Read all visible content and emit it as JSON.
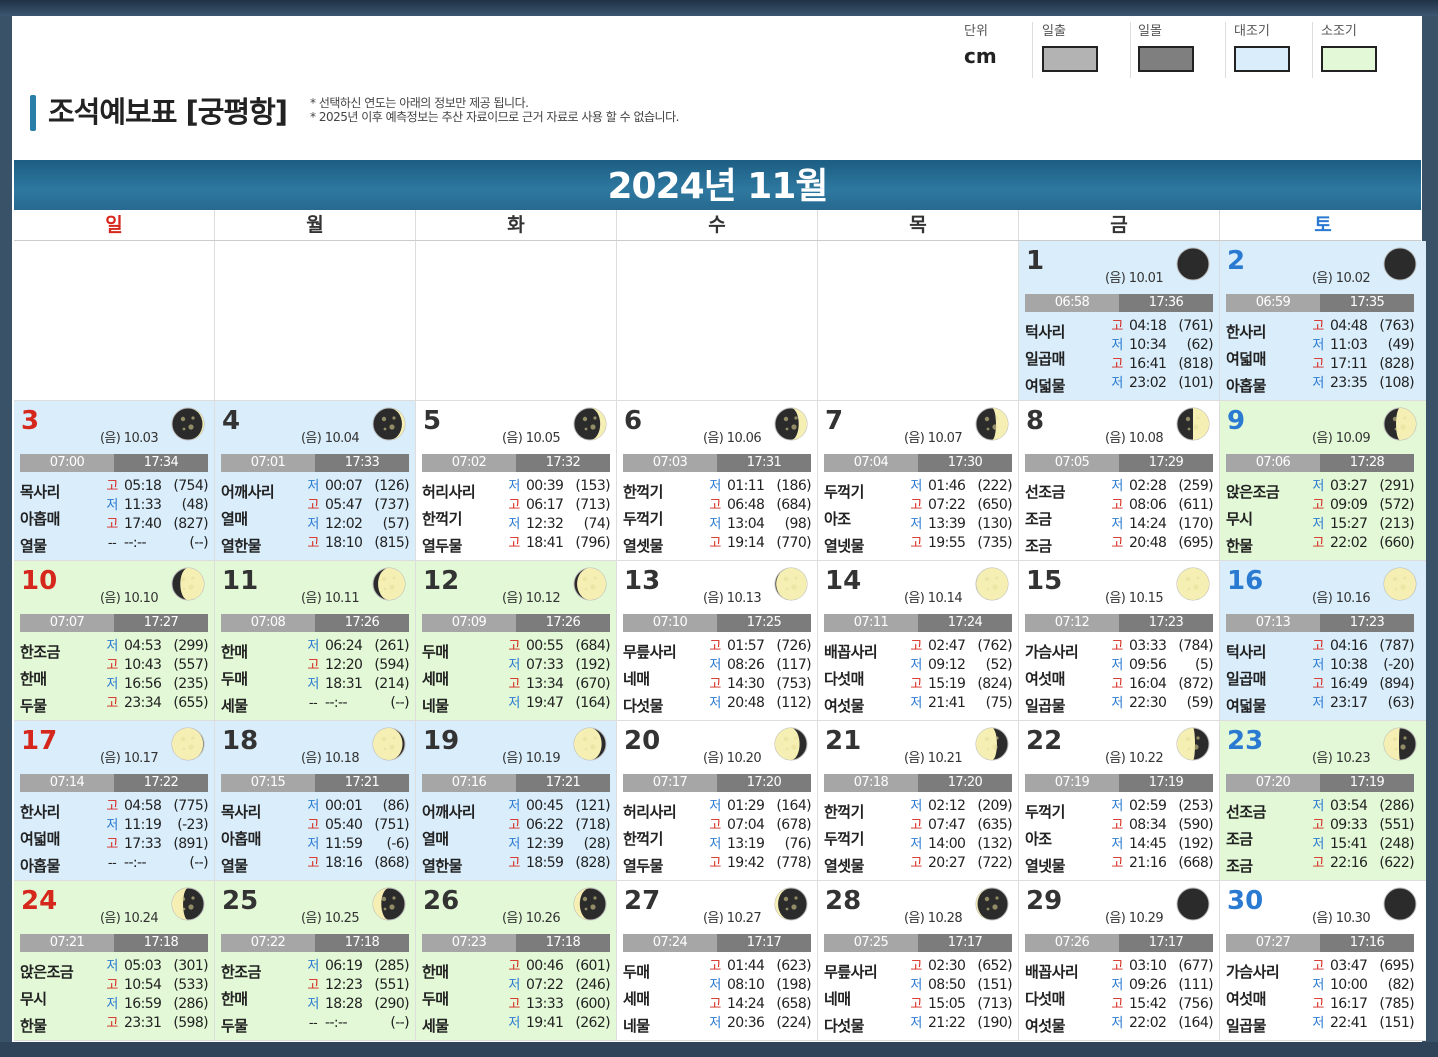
{
  "page": {
    "title": "조석예보표 [궁평항]",
    "notes": [
      "* 선택하신 연도는 아래의 정보만 제공 됩니다.",
      "* 2025년 이후 예측정보는 추산 자료이므로 근거 자료로 사용 할 수 없습니다."
    ]
  },
  "legend": {
    "unit_label": "단위",
    "unit_value": "cm",
    "items": [
      {
        "label": "일출",
        "color": "#b3b3b3"
      },
      {
        "label": "일몰",
        "color": "#7f7f7f"
      },
      {
        "label": "대조기",
        "color": "#d9edfb"
      },
      {
        "label": "소조기",
        "color": "#e2f8d6"
      }
    ]
  },
  "calendar": {
    "month_title": "2024년 11월",
    "weekdays": [
      "일",
      "월",
      "화",
      "수",
      "목",
      "금",
      "토"
    ],
    "days": [
      {
        "day": "1",
        "lunar": "(음) 10.01",
        "phase": 0.0,
        "period": "big",
        "sunrise": "06:58",
        "sunset": "17:36",
        "names": [
          "턱사리",
          "일곱매",
          "여덟물"
        ],
        "tides": [
          [
            "고",
            "04:18",
            "(761)"
          ],
          [
            "저",
            "10:34",
            "(62)"
          ],
          [
            "고",
            "16:41",
            "(818)"
          ],
          [
            "저",
            "23:02",
            "(101)"
          ]
        ]
      },
      {
        "day": "2",
        "lunar": "(음) 10.02",
        "phase": 0.03,
        "period": "big",
        "sunrise": "06:59",
        "sunset": "17:35",
        "names": [
          "한사리",
          "여덟매",
          "아홉물"
        ],
        "tides": [
          [
            "고",
            "04:48",
            "(763)"
          ],
          [
            "저",
            "11:03",
            "(49)"
          ],
          [
            "고",
            "17:11",
            "(828)"
          ],
          [
            "저",
            "23:35",
            "(108)"
          ]
        ]
      },
      {
        "day": "3",
        "lunar": "(음) 10.03",
        "phase": 0.07,
        "period": "big",
        "sunrise": "07:00",
        "sunset": "17:34",
        "names": [
          "목사리",
          "아홉매",
          "열물"
        ],
        "tides": [
          [
            "고",
            "05:18",
            "(754)"
          ],
          [
            "저",
            "11:33",
            "(48)"
          ],
          [
            "고",
            "17:40",
            "(827)"
          ],
          [
            "--",
            "--:--",
            "(--)"
          ]
        ]
      },
      {
        "day": "4",
        "lunar": "(음) 10.04",
        "phase": 0.1,
        "period": "big",
        "sunrise": "07:01",
        "sunset": "17:33",
        "names": [
          "어깨사리",
          "열매",
          "열한물"
        ],
        "tides": [
          [
            "저",
            "00:07",
            "(126)"
          ],
          [
            "고",
            "05:47",
            "(737)"
          ],
          [
            "저",
            "12:02",
            "(57)"
          ],
          [
            "고",
            "18:10",
            "(815)"
          ]
        ]
      },
      {
        "day": "5",
        "lunar": "(음) 10.05",
        "phase": 0.14,
        "period": "plain",
        "sunrise": "07:02",
        "sunset": "17:32",
        "names": [
          "허리사리",
          "한꺽기",
          "열두물"
        ],
        "tides": [
          [
            "저",
            "00:39",
            "(153)"
          ],
          [
            "고",
            "06:17",
            "(713)"
          ],
          [
            "저",
            "12:32",
            "(74)"
          ],
          [
            "고",
            "18:41",
            "(796)"
          ]
        ]
      },
      {
        "day": "6",
        "lunar": "(음) 10.06",
        "phase": 0.17,
        "period": "plain",
        "sunrise": "07:03",
        "sunset": "17:31",
        "names": [
          "한꺽기",
          "두꺽기",
          "열셋물"
        ],
        "tides": [
          [
            "저",
            "01:11",
            "(186)"
          ],
          [
            "고",
            "06:48",
            "(684)"
          ],
          [
            "저",
            "13:04",
            "(98)"
          ],
          [
            "고",
            "19:14",
            "(770)"
          ]
        ]
      },
      {
        "day": "7",
        "lunar": "(음) 10.07",
        "phase": 0.21,
        "period": "plain",
        "sunrise": "07:04",
        "sunset": "17:30",
        "names": [
          "두꺽기",
          "아조",
          "열넷물"
        ],
        "tides": [
          [
            "저",
            "01:46",
            "(222)"
          ],
          [
            "고",
            "07:22",
            "(650)"
          ],
          [
            "저",
            "13:39",
            "(130)"
          ],
          [
            "고",
            "19:55",
            "(735)"
          ]
        ]
      },
      {
        "day": "8",
        "lunar": "(음) 10.08",
        "phase": 0.25,
        "period": "plain",
        "sunrise": "07:05",
        "sunset": "17:29",
        "names": [
          "선조금",
          "조금",
          "조금"
        ],
        "tides": [
          [
            "저",
            "02:28",
            "(259)"
          ],
          [
            "고",
            "08:06",
            "(611)"
          ],
          [
            "저",
            "14:24",
            "(170)"
          ],
          [
            "고",
            "20:48",
            "(695)"
          ]
        ]
      },
      {
        "day": "9",
        "lunar": "(음) 10.09",
        "phase": 0.29,
        "period": "small",
        "sunrise": "07:06",
        "sunset": "17:28",
        "names": [
          "앉은조금",
          "무시",
          "한물"
        ],
        "tides": [
          [
            "저",
            "03:27",
            "(291)"
          ],
          [
            "고",
            "09:09",
            "(572)"
          ],
          [
            "저",
            "15:27",
            "(213)"
          ],
          [
            "고",
            "22:02",
            "(660)"
          ]
        ]
      },
      {
        "day": "10",
        "lunar": "(음) 10.10",
        "phase": 0.33,
        "period": "small",
        "sunrise": "07:07",
        "sunset": "17:27",
        "names": [
          "한조금",
          "한매",
          "두물"
        ],
        "tides": [
          [
            "저",
            "04:53",
            "(299)"
          ],
          [
            "고",
            "10:43",
            "(557)"
          ],
          [
            "저",
            "16:56",
            "(235)"
          ],
          [
            "고",
            "23:34",
            "(655)"
          ]
        ]
      },
      {
        "day": "11",
        "lunar": "(음) 10.11",
        "phase": 0.37,
        "period": "small",
        "sunrise": "07:08",
        "sunset": "17:26",
        "names": [
          "한매",
          "두매",
          "세물"
        ],
        "tides": [
          [
            "저",
            "06:24",
            "(261)"
          ],
          [
            "고",
            "12:20",
            "(594)"
          ],
          [
            "저",
            "18:31",
            "(214)"
          ],
          [
            "--",
            "--:--",
            "(--)"
          ]
        ]
      },
      {
        "day": "12",
        "lunar": "(음) 10.12",
        "phase": 0.4,
        "period": "small",
        "sunrise": "07:09",
        "sunset": "17:26",
        "names": [
          "두매",
          "세매",
          "네물"
        ],
        "tides": [
          [
            "고",
            "00:55",
            "(684)"
          ],
          [
            "저",
            "07:33",
            "(192)"
          ],
          [
            "고",
            "13:34",
            "(670)"
          ],
          [
            "저",
            "19:47",
            "(164)"
          ]
        ]
      },
      {
        "day": "13",
        "lunar": "(음) 10.13",
        "phase": 0.44,
        "period": "plain",
        "sunrise": "07:10",
        "sunset": "17:25",
        "names": [
          "무릎사리",
          "네매",
          "다섯물"
        ],
        "tides": [
          [
            "고",
            "01:57",
            "(726)"
          ],
          [
            "저",
            "08:26",
            "(117)"
          ],
          [
            "고",
            "14:30",
            "(753)"
          ],
          [
            "저",
            "20:48",
            "(112)"
          ]
        ]
      },
      {
        "day": "14",
        "lunar": "(음) 10.14",
        "phase": 0.47,
        "period": "plain",
        "sunrise": "07:11",
        "sunset": "17:24",
        "names": [
          "배꼽사리",
          "다섯매",
          "여섯물"
        ],
        "tides": [
          [
            "고",
            "02:47",
            "(762)"
          ],
          [
            "저",
            "09:12",
            "(52)"
          ],
          [
            "고",
            "15:19",
            "(824)"
          ],
          [
            "저",
            "21:41",
            "(75)"
          ]
        ]
      },
      {
        "day": "15",
        "lunar": "(음) 10.15",
        "phase": 0.5,
        "period": "plain",
        "sunrise": "07:12",
        "sunset": "17:23",
        "names": [
          "가슴사리",
          "여섯매",
          "일곱물"
        ],
        "tides": [
          [
            "고",
            "03:33",
            "(784)"
          ],
          [
            "저",
            "09:56",
            "(5)"
          ],
          [
            "고",
            "16:04",
            "(872)"
          ],
          [
            "저",
            "22:30",
            "(59)"
          ]
        ]
      },
      {
        "day": "16",
        "lunar": "(음) 10.16",
        "phase": 0.52,
        "period": "big",
        "sunrise": "07:13",
        "sunset": "17:23",
        "names": [
          "턱사리",
          "일곱매",
          "여덟물"
        ],
        "tides": [
          [
            "고",
            "04:16",
            "(787)"
          ],
          [
            "저",
            "10:38",
            "(-20)"
          ],
          [
            "고",
            "16:49",
            "(894)"
          ],
          [
            "저",
            "23:17",
            "(63)"
          ]
        ]
      },
      {
        "day": "17",
        "lunar": "(음) 10.17",
        "phase": 0.55,
        "period": "big",
        "sunrise": "07:14",
        "sunset": "17:22",
        "names": [
          "한사리",
          "여덟매",
          "아홉물"
        ],
        "tides": [
          [
            "고",
            "04:58",
            "(775)"
          ],
          [
            "저",
            "11:19",
            "(-23)"
          ],
          [
            "고",
            "17:33",
            "(891)"
          ],
          [
            "--",
            "--:--",
            "(--)"
          ]
        ]
      },
      {
        "day": "18",
        "lunar": "(음) 10.18",
        "phase": 0.59,
        "period": "big",
        "sunrise": "07:15",
        "sunset": "17:21",
        "names": [
          "목사리",
          "아홉매",
          "열물"
        ],
        "tides": [
          [
            "저",
            "00:01",
            "(86)"
          ],
          [
            "고",
            "05:40",
            "(751)"
          ],
          [
            "저",
            "11:59",
            "(-6)"
          ],
          [
            "고",
            "18:16",
            "(868)"
          ]
        ]
      },
      {
        "day": "19",
        "lunar": "(음) 10.19",
        "phase": 0.62,
        "period": "big",
        "sunrise": "07:16",
        "sunset": "17:21",
        "names": [
          "어깨사리",
          "열매",
          "열한물"
        ],
        "tides": [
          [
            "저",
            "00:45",
            "(121)"
          ],
          [
            "고",
            "06:22",
            "(718)"
          ],
          [
            "저",
            "12:39",
            "(28)"
          ],
          [
            "고",
            "18:59",
            "(828)"
          ]
        ]
      },
      {
        "day": "20",
        "lunar": "(음) 10.20",
        "phase": 0.66,
        "period": "plain",
        "sunrise": "07:17",
        "sunset": "17:20",
        "names": [
          "허리사리",
          "한꺽기",
          "열두물"
        ],
        "tides": [
          [
            "저",
            "01:29",
            "(164)"
          ],
          [
            "고",
            "07:04",
            "(678)"
          ],
          [
            "저",
            "13:19",
            "(76)"
          ],
          [
            "고",
            "19:42",
            "(778)"
          ]
        ]
      },
      {
        "day": "21",
        "lunar": "(음) 10.21",
        "phase": 0.7,
        "period": "plain",
        "sunrise": "07:18",
        "sunset": "17:20",
        "names": [
          "한꺽기",
          "두꺽기",
          "열셋물"
        ],
        "tides": [
          [
            "저",
            "02:12",
            "(209)"
          ],
          [
            "고",
            "07:47",
            "(635)"
          ],
          [
            "저",
            "14:00",
            "(132)"
          ],
          [
            "고",
            "20:27",
            "(722)"
          ]
        ]
      },
      {
        "day": "22",
        "lunar": "(음) 10.22",
        "phase": 0.73,
        "period": "plain",
        "sunrise": "07:19",
        "sunset": "17:19",
        "names": [
          "두꺽기",
          "아조",
          "열넷물"
        ],
        "tides": [
          [
            "저",
            "02:59",
            "(253)"
          ],
          [
            "고",
            "08:34",
            "(590)"
          ],
          [
            "저",
            "14:45",
            "(192)"
          ],
          [
            "고",
            "21:16",
            "(668)"
          ]
        ]
      },
      {
        "day": "23",
        "lunar": "(음) 10.23",
        "phase": 0.76,
        "period": "small",
        "sunrise": "07:20",
        "sunset": "17:19",
        "names": [
          "선조금",
          "조금",
          "조금"
        ],
        "tides": [
          [
            "저",
            "03:54",
            "(286)"
          ],
          [
            "고",
            "09:33",
            "(551)"
          ],
          [
            "저",
            "15:41",
            "(248)"
          ],
          [
            "고",
            "22:16",
            "(622)"
          ]
        ]
      },
      {
        "day": "24",
        "lunar": "(음) 10.24",
        "phase": 0.8,
        "period": "small",
        "sunrise": "07:21",
        "sunset": "17:18",
        "names": [
          "앉은조금",
          "무시",
          "한물"
        ],
        "tides": [
          [
            "저",
            "05:03",
            "(301)"
          ],
          [
            "고",
            "10:54",
            "(533)"
          ],
          [
            "저",
            "16:59",
            "(286)"
          ],
          [
            "고",
            "23:31",
            "(598)"
          ]
        ]
      },
      {
        "day": "25",
        "lunar": "(음) 10.25",
        "phase": 0.83,
        "period": "small",
        "sunrise": "07:22",
        "sunset": "17:18",
        "names": [
          "한조금",
          "한매",
          "두물"
        ],
        "tides": [
          [
            "저",
            "06:19",
            "(285)"
          ],
          [
            "고",
            "12:23",
            "(551)"
          ],
          [
            "저",
            "18:28",
            "(290)"
          ],
          [
            "--",
            "--:--",
            "(--)"
          ]
        ]
      },
      {
        "day": "26",
        "lunar": "(음) 10.26",
        "phase": 0.86,
        "period": "small",
        "sunrise": "07:23",
        "sunset": "17:18",
        "names": [
          "한매",
          "두매",
          "세물"
        ],
        "tides": [
          [
            "고",
            "00:46",
            "(601)"
          ],
          [
            "저",
            "07:22",
            "(246)"
          ],
          [
            "고",
            "13:33",
            "(600)"
          ],
          [
            "저",
            "19:41",
            "(262)"
          ]
        ]
      },
      {
        "day": "27",
        "lunar": "(음) 10.27",
        "phase": 0.9,
        "period": "plain",
        "sunrise": "07:24",
        "sunset": "17:17",
        "names": [
          "두매",
          "세매",
          "네물"
        ],
        "tides": [
          [
            "고",
            "01:44",
            "(623)"
          ],
          [
            "저",
            "08:10",
            "(198)"
          ],
          [
            "고",
            "14:24",
            "(658)"
          ],
          [
            "저",
            "20:36",
            "(224)"
          ]
        ]
      },
      {
        "day": "28",
        "lunar": "(음) 10.28",
        "phase": 0.93,
        "period": "plain",
        "sunrise": "07:25",
        "sunset": "17:17",
        "names": [
          "무릎사리",
          "네매",
          "다섯물"
        ],
        "tides": [
          [
            "고",
            "02:30",
            "(652)"
          ],
          [
            "저",
            "08:50",
            "(151)"
          ],
          [
            "고",
            "15:05",
            "(713)"
          ],
          [
            "저",
            "21:22",
            "(190)"
          ]
        ]
      },
      {
        "day": "29",
        "lunar": "(음) 10.29",
        "phase": 0.96,
        "period": "plain",
        "sunrise": "07:26",
        "sunset": "17:17",
        "names": [
          "배꼽사리",
          "다섯매",
          "여섯물"
        ],
        "tides": [
          [
            "고",
            "03:10",
            "(677)"
          ],
          [
            "저",
            "09:26",
            "(111)"
          ],
          [
            "고",
            "15:42",
            "(756)"
          ],
          [
            "저",
            "22:02",
            "(164)"
          ]
        ]
      },
      {
        "day": "30",
        "lunar": "(음) 10.30",
        "phase": 0.99,
        "period": "plain",
        "sunrise": "07:27",
        "sunset": "17:16",
        "names": [
          "가슴사리",
          "여섯매",
          "일곱물"
        ],
        "tides": [
          [
            "고",
            "03:47",
            "(695)"
          ],
          [
            "저",
            "10:00",
            "(82)"
          ],
          [
            "고",
            "16:17",
            "(785)"
          ],
          [
            "저",
            "22:41",
            "(151)"
          ]
        ]
      }
    ]
  }
}
